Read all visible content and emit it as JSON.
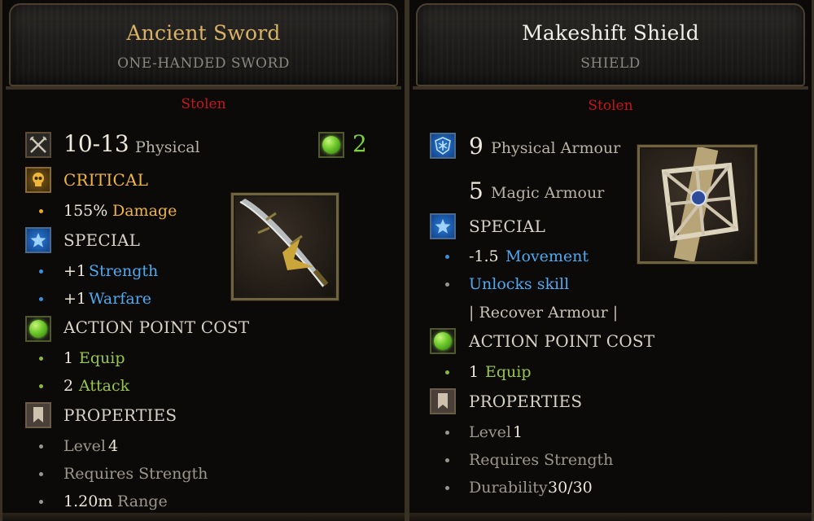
{
  "left": {
    "title": "Ancient Sword",
    "subtitle": "ONE-HANDED SWORD",
    "stolen": "Stolen",
    "damage_value": "10-13",
    "damage_type": "Physical",
    "ap_cost": "2",
    "critical_header": "CRITICAL",
    "critical_value": "155%",
    "critical_label": "Damage",
    "special_header": "SPECIAL",
    "special_items": [
      {
        "value": "+1",
        "label": "Strength"
      },
      {
        "value": "+1",
        "label": "Warfare"
      }
    ],
    "ap_header": "ACTION POINT COST",
    "ap_items": [
      {
        "value": "1",
        "label": "Equip"
      },
      {
        "value": "2",
        "label": "Attack"
      }
    ],
    "properties_header": "PROPERTIES",
    "properties": [
      {
        "label": "Level",
        "value": "4"
      },
      {
        "label": "Requires Strength",
        "value": ""
      },
      {
        "label": "Range",
        "value": "1.20m"
      }
    ]
  },
  "right": {
    "title": "Makeshift Shield",
    "subtitle": "SHIELD",
    "stolen": "Stolen",
    "physical_armour_value": "9",
    "physical_armour_label": "Physical Armour",
    "magic_armour_value": "5",
    "magic_armour_label": "Magic Armour",
    "special_header": "SPECIAL",
    "movement_value": "-1.5",
    "movement_label": "Movement",
    "unlocks_label": "Unlocks skill",
    "skill_name": "| Recover Armour |",
    "ap_header": "ACTION POINT COST",
    "ap_equip_value": "1",
    "ap_equip_label": "Equip",
    "properties_header": "PROPERTIES",
    "properties": [
      {
        "label": "Level",
        "value": "1"
      },
      {
        "label": "Requires Strength",
        "value": ""
      },
      {
        "label": "Durability",
        "value": "30/30"
      }
    ]
  },
  "colors": {
    "stolen": "#c8161a",
    "gold_text": "#f0b63a",
    "blue_text": "#4fa9f0",
    "green_text": "#98c64a"
  },
  "icons": {
    "damage": "crossed-swords-icon",
    "ap": "green-orb-icon",
    "critical": "skull-icon",
    "special": "star-icon",
    "properties": "bookmark-icon",
    "armour": "snowflake-shield-icon"
  }
}
